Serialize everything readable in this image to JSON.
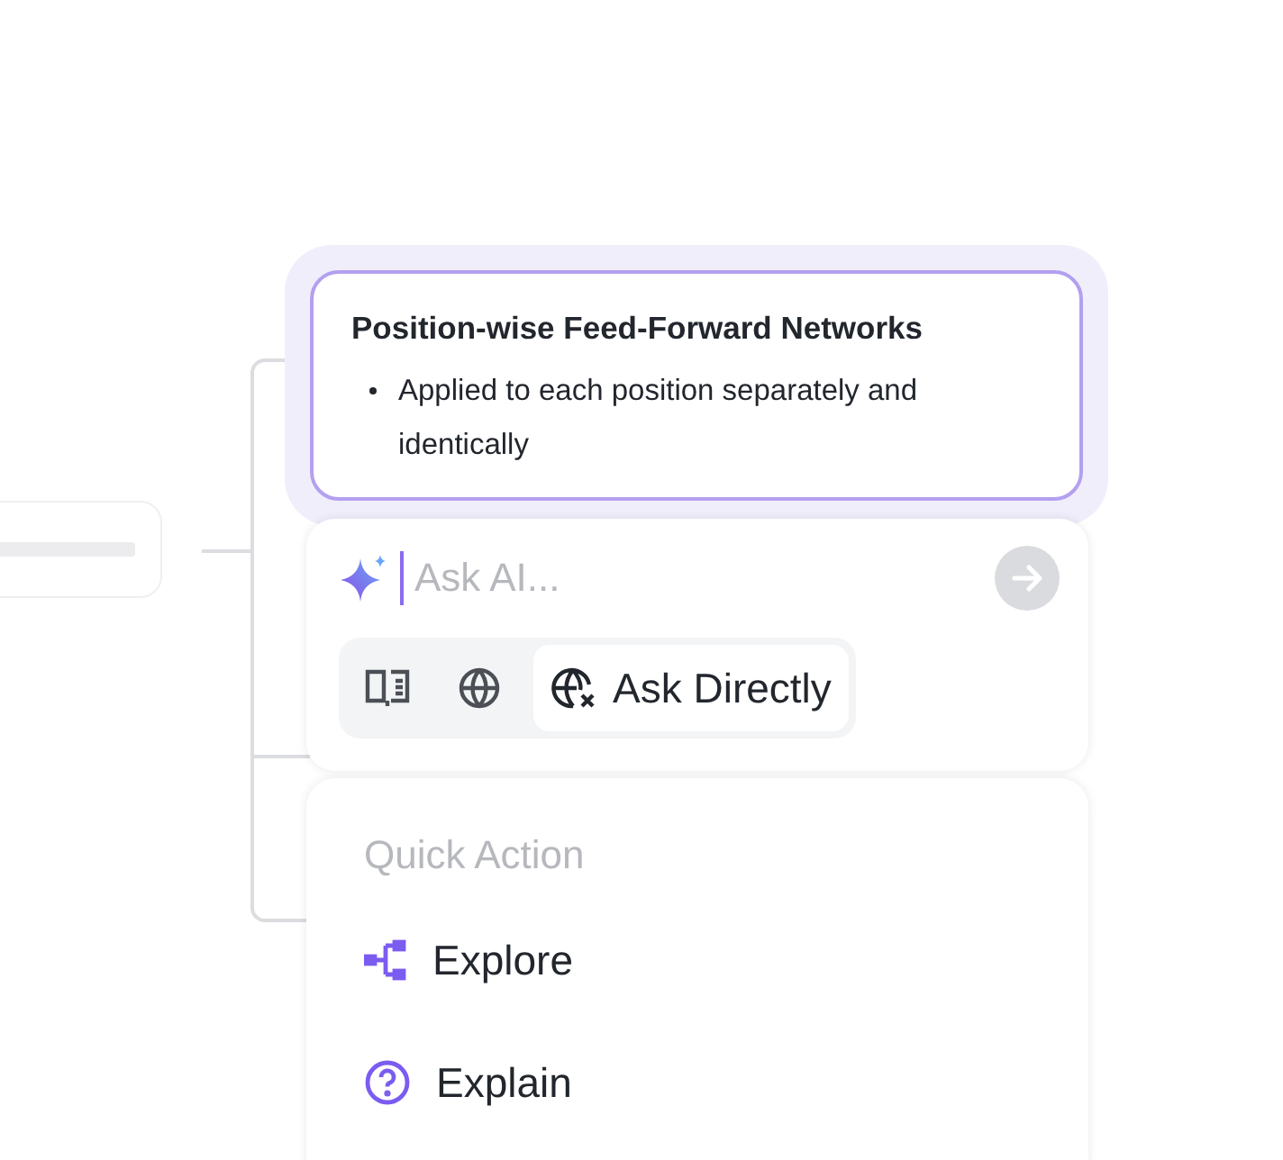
{
  "node": {
    "title": "Position-wise Feed-Forward Networks",
    "bullets": [
      "Applied to each position separately and identically"
    ],
    "selected": true
  },
  "ask": {
    "placeholder": "Ask AI...",
    "modes": [
      {
        "kind": "book",
        "selected": false
      },
      {
        "kind": "globe",
        "selected": false
      },
      {
        "kind": "globe-off",
        "label": "Ask Directly",
        "selected": true
      }
    ]
  },
  "quick_actions": {
    "heading": "Quick Action",
    "items": [
      {
        "kind": "explore",
        "label": "Explore"
      },
      {
        "kind": "explain",
        "label": "Explain"
      }
    ]
  }
}
